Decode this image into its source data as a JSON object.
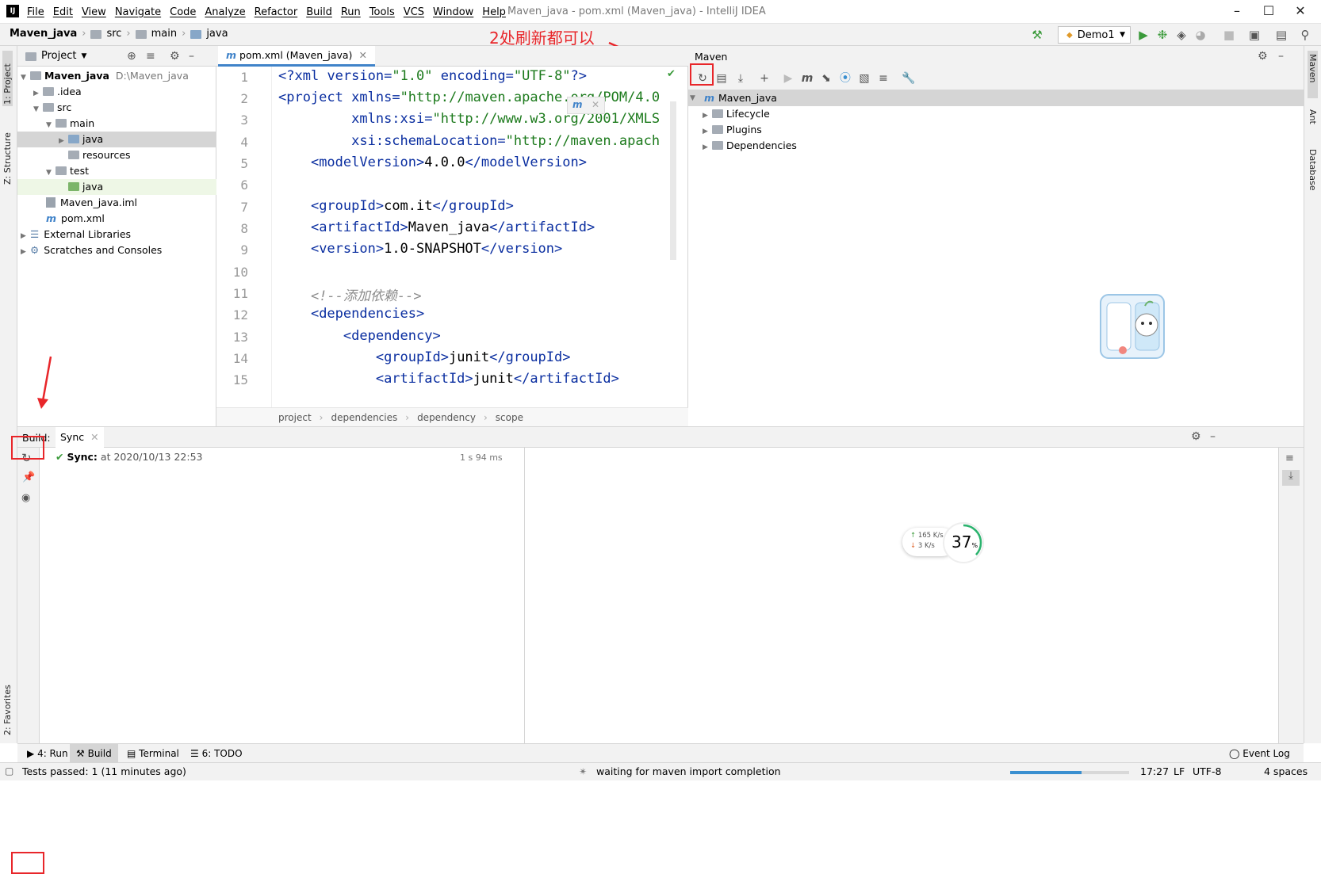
{
  "window": {
    "title": "Maven_java - pom.xml (Maven_java) - IntelliJ IDEA",
    "menu": [
      "File",
      "Edit",
      "View",
      "Navigate",
      "Code",
      "Analyze",
      "Refactor",
      "Build",
      "Run",
      "Tools",
      "VCS",
      "Window",
      "Help"
    ]
  },
  "navbar": {
    "crumbs": [
      "Maven_java",
      "src",
      "main",
      "java"
    ],
    "run_config": "Demo1"
  },
  "annotation": "2处刷新都可以",
  "project": {
    "header": "Project",
    "tree": [
      {
        "label": "Maven_java",
        "extra": "D:\\Maven_java"
      },
      {
        "label": ".idea"
      },
      {
        "label": "src"
      },
      {
        "label": "main"
      },
      {
        "label": "java"
      },
      {
        "label": "resources"
      },
      {
        "label": "test"
      },
      {
        "label": "java"
      },
      {
        "label": "Maven_java.iml"
      },
      {
        "label": "pom.xml"
      },
      {
        "label": "External Libraries"
      },
      {
        "label": "Scratches and Consoles"
      }
    ]
  },
  "editor": {
    "tab": "pom.xml (Maven_java)",
    "line_numbers": [
      "1",
      "2",
      "3",
      "4",
      "5",
      "6",
      "7",
      "8",
      "9",
      "10",
      "11",
      "12",
      "13",
      "14",
      "15"
    ],
    "breadcrumbs": [
      "project",
      "dependencies",
      "dependency",
      "scope"
    ]
  },
  "maven": {
    "header": "Maven",
    "root": "Maven_java",
    "items": [
      "Lifecycle",
      "Plugins",
      "Dependencies"
    ]
  },
  "build": {
    "label": "Build:",
    "tab": "Sync",
    "sync_title": "Sync:",
    "sync_time": "at 2020/10/13 22:53",
    "duration": "1 s 94 ms"
  },
  "speed_widget": {
    "up": "165 K/s",
    "down": "3  K/s",
    "percent": "37",
    "unit": "%"
  },
  "left_stripe": {
    "project": "1: Project",
    "structure": "Z: Structure",
    "favorites": "2: Favorites"
  },
  "right_stripe": {
    "maven": "Maven",
    "ant": "Ant",
    "database": "Database"
  },
  "tool_tabs": {
    "run": "4: Run",
    "build": "Build",
    "terminal": "Terminal",
    "todo": "6: TODO",
    "event_log": "Event Log"
  },
  "status": {
    "left": "Tests passed: 1 (11 minutes ago)",
    "center": "waiting for maven import completion",
    "position": "17:27",
    "line_sep": "LF",
    "encoding": "UTF-8",
    "indent": "4 spaces",
    "progress": 0.6
  }
}
